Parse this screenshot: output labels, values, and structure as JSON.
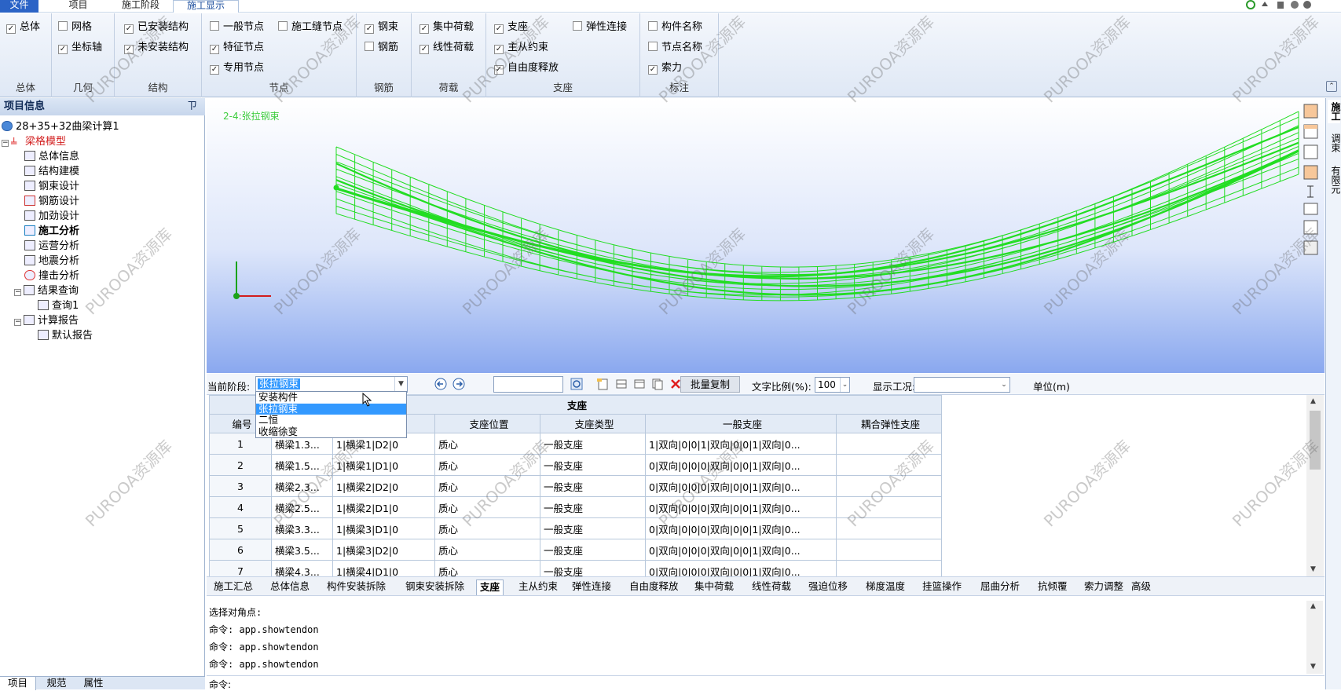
{
  "tabs": {
    "file": "文件",
    "items": [
      "项目",
      "施工阶段",
      "施工显示"
    ],
    "active": "施工显示"
  },
  "ribbon": {
    "groups": [
      {
        "label": "总体",
        "items": [
          {
            "text": "总体",
            "checked": true
          }
        ]
      },
      {
        "label": "几何",
        "items": [
          {
            "text": "网格",
            "checked": false
          },
          {
            "text": "坐标轴",
            "checked": true
          }
        ]
      },
      {
        "label": "结构",
        "items": [
          {
            "text": "已安装结构",
            "checked": true
          },
          {
            "text": "未安装结构",
            "checked": true
          }
        ]
      },
      {
        "label": "节点",
        "items": [
          {
            "text": "一般节点",
            "checked": false
          },
          {
            "text": "施工缝节点",
            "checked": false
          },
          {
            "text": "特征节点",
            "checked": true
          },
          {
            "text": "专用节点",
            "checked": true
          }
        ]
      },
      {
        "label": "钢筋",
        "items": [
          {
            "text": "钢束",
            "checked": true
          },
          {
            "text": "钢筋",
            "checked": false
          }
        ]
      },
      {
        "label": "荷载",
        "items": [
          {
            "text": "集中荷载",
            "checked": true
          },
          {
            "text": "线性荷载",
            "checked": true
          }
        ]
      },
      {
        "label": "支座",
        "items": [
          {
            "text": "支座",
            "checked": true
          },
          {
            "text": "弹性连接",
            "checked": false
          },
          {
            "text": "主从约束",
            "checked": true
          },
          {
            "text": "自由度释放",
            "checked": true
          }
        ]
      },
      {
        "label": "标注",
        "items": [
          {
            "text": "构件名称",
            "checked": false
          },
          {
            "text": "节点名称",
            "checked": false
          },
          {
            "text": "索力",
            "checked": true
          }
        ]
      }
    ]
  },
  "left_panel": {
    "title": "项目信息",
    "pin": "ㄗ",
    "root": "28+35+32曲梁计算1",
    "model": "梁格模型",
    "items": [
      "总体信息",
      "结构建模",
      "钢束设计",
      "钢筋设计",
      "加劲设计",
      "施工分析",
      "运营分析",
      "地震分析",
      "撞击分析",
      "结果查询",
      "查询1",
      "计算报告",
      "默认报告"
    ],
    "bottom_tabs": [
      "项目",
      "规范",
      "属性"
    ]
  },
  "viewport": {
    "stage_label": "2-4:张拉钢束",
    "model_color": "#22dd22"
  },
  "right_tabs": [
    "施工",
    "调束",
    "有限元"
  ],
  "stagebar": {
    "stage_label": "当前阶段:",
    "stage_value": "张拉钢束",
    "batch_copy": "批量复制",
    "text_scale_label": "文字比例(%):",
    "text_scale_value": "100",
    "case_label": "显示工况:",
    "case_value": "",
    "unit_label": "单位(m)"
  },
  "dropdown_options": [
    "安装构件",
    "张拉钢束",
    "二恒",
    "收缩徐变"
  ],
  "table": {
    "title": "支座",
    "columns": [
      "编号",
      "",
      "",
      "支座位置",
      "支座类型",
      "一般支座",
      "耦合弹性支座"
    ],
    "rows": [
      [
        "1",
        "横梁1.3...",
        "1|横梁1|D2|0",
        "质心",
        "一般支座",
        "1|双向|0|0|1|双向|0|0|1|双向|0...",
        ""
      ],
      [
        "2",
        "横梁1.5...",
        "1|横梁1|D1|0",
        "质心",
        "一般支座",
        "0|双向|0|0|0|双向|0|0|1|双向|0...",
        ""
      ],
      [
        "3",
        "横梁2.3...",
        "1|横梁2|D2|0",
        "质心",
        "一般支座",
        "0|双向|0|0|0|双向|0|0|1|双向|0...",
        ""
      ],
      [
        "4",
        "横梁2.5...",
        "1|横梁2|D1|0",
        "质心",
        "一般支座",
        "0|双向|0|0|0|双向|0|0|1|双向|0...",
        ""
      ],
      [
        "5",
        "横梁3.3...",
        "1|横梁3|D1|0",
        "质心",
        "一般支座",
        "0|双向|0|0|0|双向|0|0|1|双向|0...",
        ""
      ],
      [
        "6",
        "横梁3.5...",
        "1|横梁3|D2|0",
        "质心",
        "一般支座",
        "0|双向|0|0|0|双向|0|0|1|双向|0...",
        ""
      ],
      [
        "7",
        "横梁4.3...",
        "1|横梁4|D1|0",
        "质心",
        "一般支座",
        "0|双向|0|0|0|双向|0|0|1|双向|0...",
        ""
      ]
    ]
  },
  "page_tabs": [
    "施工汇总",
    "总体信息",
    "构件安装拆除",
    "钢束安装拆除",
    "支座",
    "主从约束",
    "弹性连接",
    "自由度释放",
    "集中荷载",
    "线性荷载",
    "强迫位移",
    "梯度温度",
    "挂篮操作",
    "屈曲分析",
    "抗倾覆",
    "索力调整",
    "高级"
  ],
  "active_page_tab": "支座",
  "console": {
    "lines": [
      "选择对角点:",
      "命令: app.showtendon",
      "命令: app.showtendon",
      "命令: app.showtendon"
    ],
    "prompt": "命令:"
  },
  "watermark": "PUROOA资源库"
}
